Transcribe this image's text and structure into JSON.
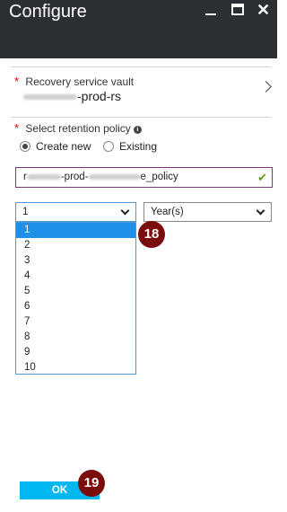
{
  "window": {
    "title": "Configure",
    "minimize_icon": "minimize-icon",
    "maximize_icon": "maximize-icon",
    "close_icon": "close-icon",
    "close_glyph": "✕"
  },
  "vault": {
    "required_mark": "*",
    "label": "Recovery service vault",
    "value_suffix": "-prod-rs"
  },
  "retention": {
    "required_mark": "*",
    "label": "Select retention policy",
    "info_glyph": "i",
    "options": [
      {
        "label": "Create new",
        "selected": true
      },
      {
        "label": "Existing",
        "selected": false
      }
    ],
    "name_part1": "r",
    "name_part2": "-prod-",
    "name_part3": "e_policy",
    "valid_glyph": "✔"
  },
  "duration": {
    "selected_value": "1",
    "unit_value": "Year(s)",
    "options": [
      "1",
      "2",
      "3",
      "4",
      "5",
      "6",
      "7",
      "8",
      "9",
      "10"
    ]
  },
  "callouts": {
    "step_18": "18",
    "step_19": "19"
  },
  "footer": {
    "ok_label": "OK"
  },
  "colors": {
    "header_bg": "#2b2f33",
    "accent": "#00b7f0",
    "selection": "#1e90e8",
    "callout": "#7a0c0c",
    "valid": "#5ba21b"
  }
}
